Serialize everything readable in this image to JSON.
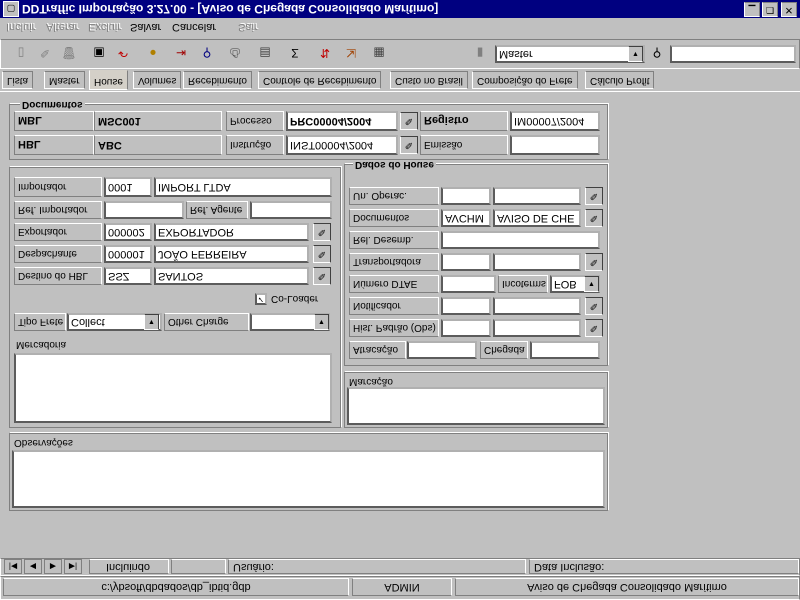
{
  "window": {
    "title": "DDTraffic Importação 3.27.00 - [Aviso de Chegada Consolidado Marítimo]",
    "icon": "app-icon"
  },
  "status": {
    "path": "c:/ybsoft/dbdados/db_ibtid.gdb",
    "user": "ADMIN",
    "form": "Aviso de Chegada Consolidado Marítimo",
    "state": "Incluindo",
    "usuario_label": "Usuário:",
    "data_label": "Data Inclusão:"
  },
  "menu": [
    "Incluir",
    "Alterar",
    "Excluir",
    "Salvar",
    "Cancelar",
    "Sair"
  ],
  "toolbar": {
    "filter_value": "Master"
  },
  "tabs": [
    "Lista",
    "Master",
    "House",
    "Volumes",
    "Recebimento",
    "Controle de Recebimento",
    "Custo no Brasil",
    "Composição do Frete",
    "Cálculo Profit"
  ],
  "obs_label": "Observações",
  "mercadoria_label": "Mercadoria",
  "tipo_frete": {
    "label": "Tipo Frete",
    "value": "Collect"
  },
  "other_charge": {
    "label": "Other Charge",
    "value": ""
  },
  "coloader": "Co-Loader",
  "destino": {
    "label": "Destino do HBL",
    "code": "SSZ",
    "name": "SANTOS"
  },
  "despachante": {
    "label": "Despachante",
    "code": "000001",
    "name": "JOÃO FERREIRA"
  },
  "exportador": {
    "label": "Exportador",
    "code": "000002",
    "name": "EXPORTADOR"
  },
  "refs": {
    "imp_label": "Ref. Importador",
    "imp_value": "",
    "agente_label": "Ref. Agente",
    "agente_value": ""
  },
  "importador": {
    "label": "Importador",
    "code": "0001",
    "name": "IMPORT LTDA"
  },
  "marcacao_label": "Marcação",
  "atracacao": {
    "label": "Atracação",
    "value": ""
  },
  "chegada": {
    "label": "Chegada",
    "value": ""
  },
  "hist": {
    "label": "Hist. Padrão (Obs)"
  },
  "notificador": {
    "label": "Notificador"
  },
  "dtae": {
    "label": "Número DTAE",
    "value": ""
  },
  "incoterms": {
    "label": "Incoterms",
    "value": "FOB"
  },
  "transportadora": {
    "label": "Transportadora"
  },
  "rel_desemb": {
    "label": "Rel. Desemb.",
    "value": ""
  },
  "documentos": {
    "label": "Documentos",
    "code": "AVCHM",
    "name": "AVISO DE CHE"
  },
  "un_operac": {
    "label": "Un. Operac."
  },
  "house_group": "Dados do House",
  "docs_group": "Documentos",
  "hbl": {
    "label": "HBL",
    "value": "ABC"
  },
  "mbl": {
    "label": "MBL",
    "value": "MSC001"
  },
  "instrucao": {
    "label": "Instrução",
    "value": "INST00004/2004"
  },
  "processo": {
    "label": "Processo",
    "value": "PRC00004/2004"
  },
  "emissao": {
    "label": "Emissão",
    "value": ""
  },
  "registro": {
    "label": "Registro",
    "value": "IM00007/2004"
  }
}
